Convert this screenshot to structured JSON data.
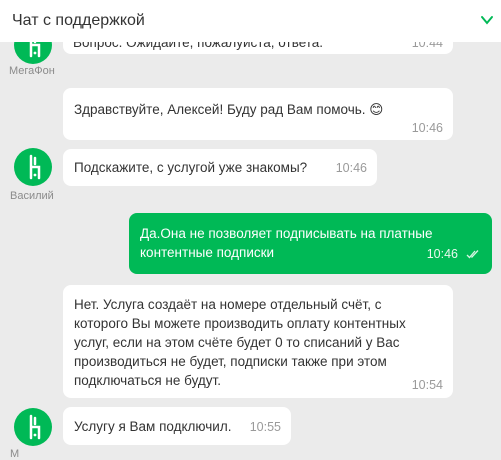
{
  "header": {
    "title": "Чат с поддержкой"
  },
  "messages": [
    {
      "text": "Вопрос. Ожидайте, пожалуйста, ответа.",
      "time": "10:44"
    },
    {
      "text": "Здравствуйте, Алексей! Буду рад Вам помочь. 😊",
      "time": "10:46"
    },
    {
      "text": "Подскажите, с услугой уже знакомы?",
      "time": "10:46"
    },
    {
      "text": "Да.Она не позволяет подписывать на платные контентные подписки",
      "time": "10:46"
    },
    {
      "text": "Нет. Услуга создаёт на номере отдельный счёт, с которого Вы можете производить оплату контентных услуг, если на этом счёте будет 0 то списаний у Вас производиться не будет, подписки также при этом подключаться не будут.",
      "time": "10:54"
    },
    {
      "text": "Услугу я Вам подключил.",
      "time": "10:55"
    }
  ],
  "senders": {
    "first": "МегаФон",
    "second": "Василий",
    "third": "М"
  },
  "colors": {
    "brand_green": "#00b956",
    "background": "#ebebeb"
  }
}
